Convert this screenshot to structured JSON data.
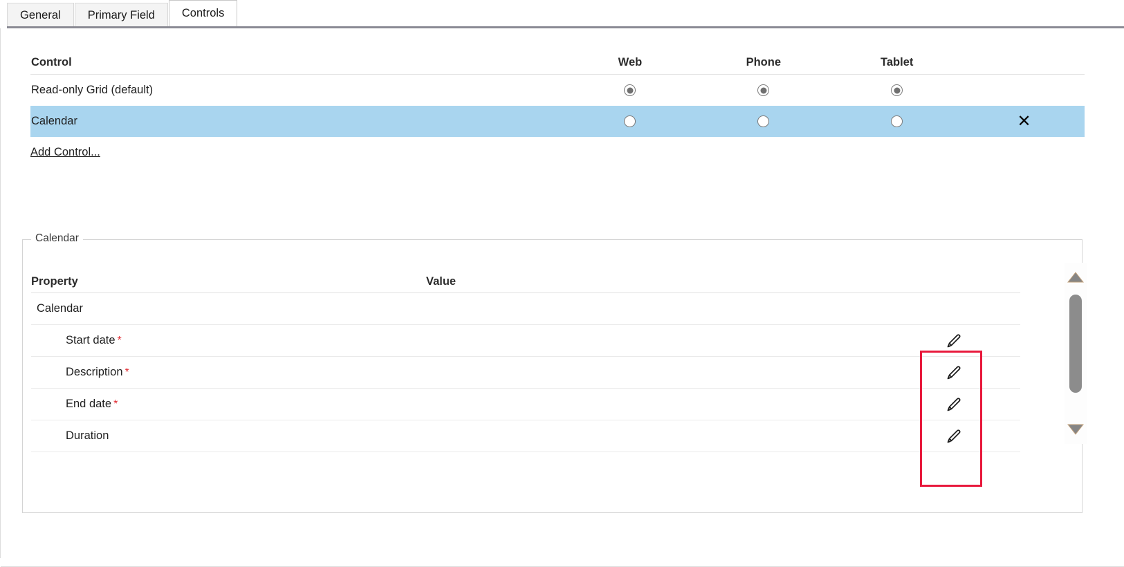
{
  "tabs": [
    {
      "label": "General",
      "active": false
    },
    {
      "label": "Primary Field",
      "active": false
    },
    {
      "label": "Controls",
      "active": true
    }
  ],
  "controls_table": {
    "headers": {
      "control": "Control",
      "web": "Web",
      "phone": "Phone",
      "tablet": "Tablet"
    },
    "rows": [
      {
        "name": "Read-only Grid (default)",
        "web": "checked",
        "phone": "checked",
        "tablet": "checked",
        "selected": false,
        "deletable": false
      },
      {
        "name": "Calendar",
        "web": "unchecked",
        "phone": "unchecked",
        "tablet": "unchecked",
        "selected": true,
        "deletable": true,
        "delete_glyph": "✕"
      }
    ],
    "add_control_label": "Add Control..."
  },
  "properties_panel": {
    "legend": "Calendar",
    "headers": {
      "property": "Property",
      "value": "Value"
    },
    "rows": [
      {
        "label": "Calendar",
        "required": false,
        "value": "",
        "type": "group",
        "edit": true
      },
      {
        "label": "Start date",
        "required": true,
        "value": "",
        "type": "child",
        "edit": true,
        "required_marker": "*"
      },
      {
        "label": "Description",
        "required": true,
        "value": "",
        "type": "child",
        "edit": true,
        "required_marker": "*"
      },
      {
        "label": "End date",
        "required": true,
        "value": "",
        "type": "child",
        "edit": true,
        "required_marker": "*"
      },
      {
        "label": "Duration",
        "required": false,
        "value": "",
        "type": "child",
        "edit": true
      }
    ]
  },
  "highlight": {
    "color": "#e8193c",
    "note": "edit-pencil-column"
  },
  "scrollbar": {
    "up_arrow": "▲",
    "down_arrow": "▼",
    "thumb_color": "#8c8c8c"
  },
  "colors": {
    "selected_row": "#a9d5ef",
    "required_asterisk": "#e12d34",
    "tab_underline": "#8a8a94"
  }
}
